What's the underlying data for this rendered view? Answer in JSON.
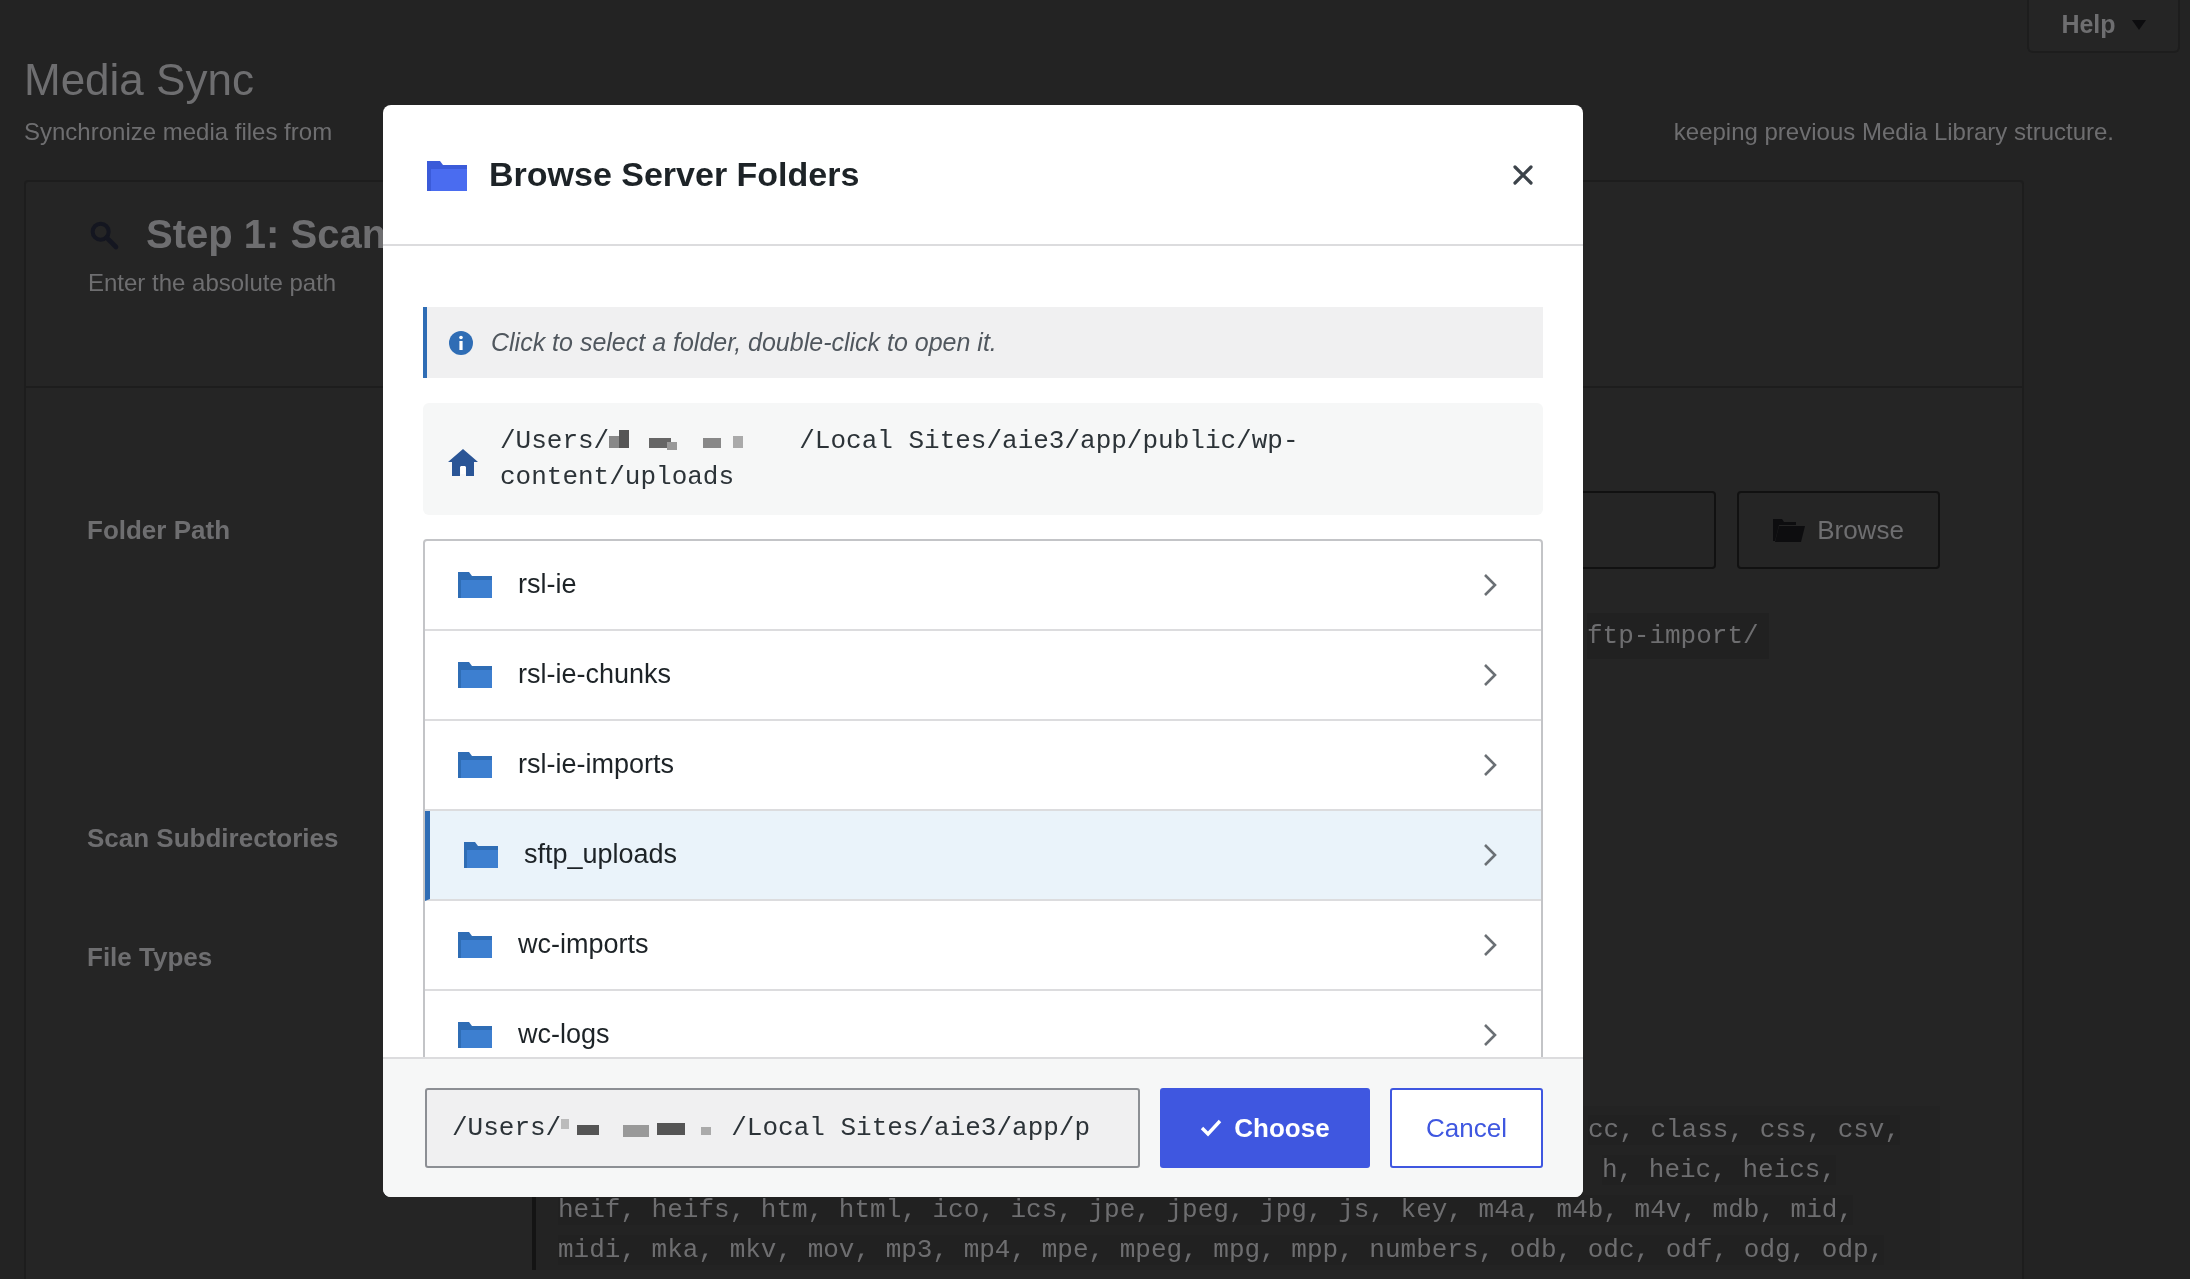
{
  "page": {
    "title": "Media Sync",
    "subtitle_left": "Synchronize media files from",
    "subtitle_right": "keeping previous Media Library structure.",
    "help_button": "Help"
  },
  "card": {
    "step_title": "Step 1: Scan",
    "step_desc": "Enter the absolute path",
    "folder_path_label": "Folder Path",
    "browse_button": "Browse",
    "path_example": "ftp-import/",
    "scan_subdirectories_label": "Scan Subdirectories",
    "file_types_label": "File Types",
    "file_types_tails": [
      "cc, class, css, csv,",
      "h, heic, heics,"
    ],
    "file_types_lines": [
      "heif, heifs, htm, html, ico, ics, jpe, jpeg, jpg, js, key, m4a, m4b, m4v, mdb, mid,",
      "midi, mka, mkv, mov, mp3, mp4, mpe, mpeg, mpg, mpp, numbers, odb, odc, odf, odg, odp,"
    ]
  },
  "dialog": {
    "title": "Browse Server Folders",
    "notice": "Click to select a folder, double-click to open it.",
    "current_path": {
      "start": "/Users/",
      "end": "/Local Sites/aie3/app/public/wp-content/uploads"
    },
    "folders": [
      {
        "name": "rsl-ie",
        "selected": false
      },
      {
        "name": "rsl-ie-chunks",
        "selected": false
      },
      {
        "name": "rsl-ie-imports",
        "selected": false
      },
      {
        "name": "sftp_uploads",
        "selected": true
      },
      {
        "name": "wc-imports",
        "selected": false
      },
      {
        "name": "wc-logs",
        "selected": false
      }
    ],
    "path_field": {
      "start": "/Users/",
      "end": "/Local Sites/aie3/app/p"
    },
    "choose_button": "Choose",
    "cancel_button": "Cancel"
  }
}
